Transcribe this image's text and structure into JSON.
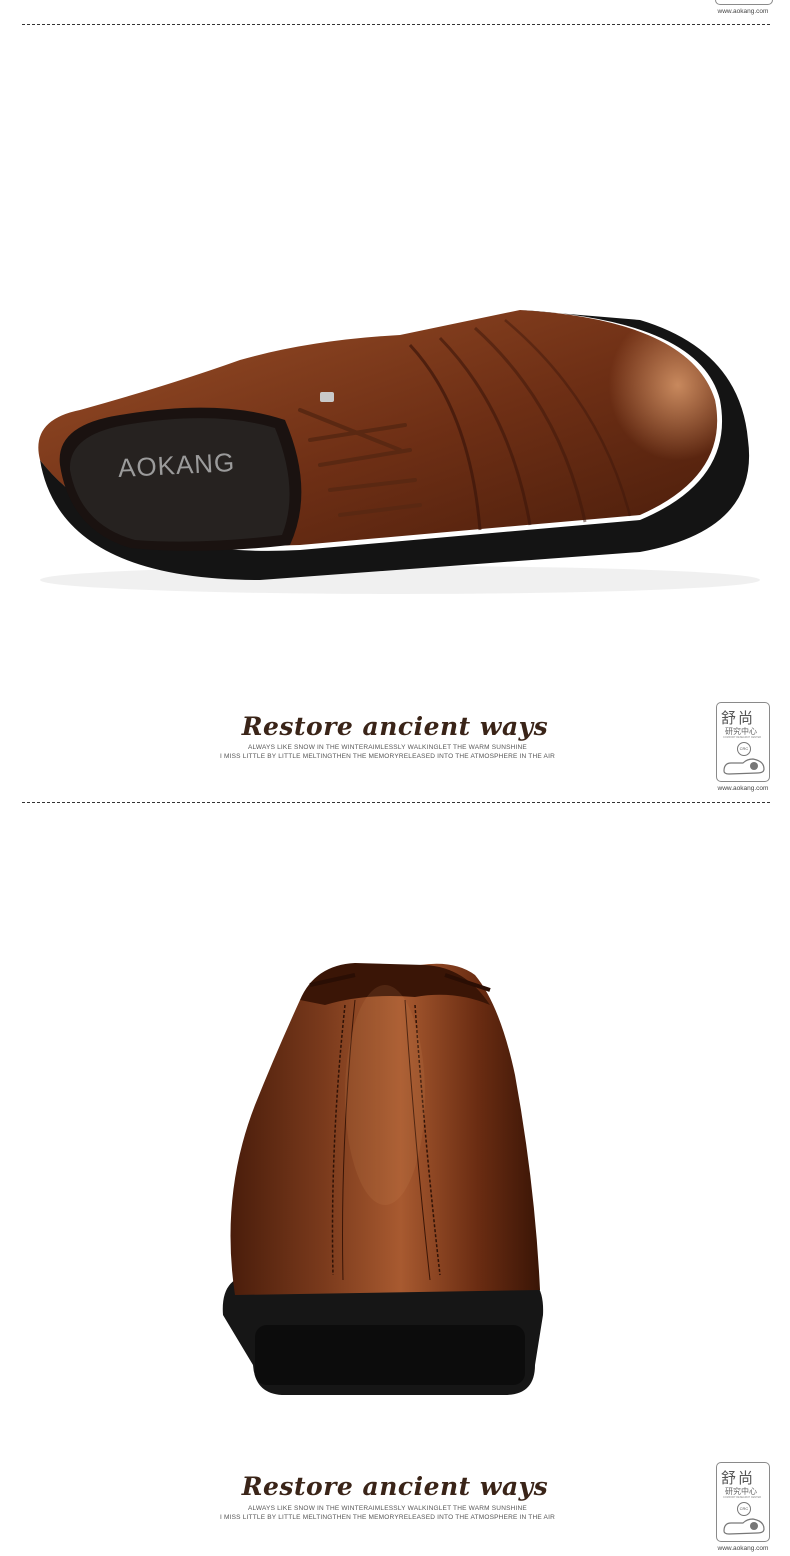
{
  "brand": {
    "insole_logo": "AOKANG"
  },
  "sections": [
    {
      "title": "Restore ancient ways",
      "line1": "ALWAYS LIKE SNOW IN THE WINTERAIMLESSLY WALKINGLET THE WARM SUNSHINE",
      "line2": "I MISS LITTLE BY LITTLE MELTINGTHEN THE MEMORYRELEASED INTO THE ATMOSPHERE IN THE AIR"
    },
    {
      "title": "Restore ancient ways",
      "line1": "ALWAYS LIKE SNOW IN THE WINTERAIMLESSLY WALKINGLET THE WARM SUNSHINE",
      "line2": "I MISS LITTLE BY LITTLE MELTINGTHEN THE MEMORYRELEASED INTO THE ATMOSPHERE IN THE AIR"
    }
  ],
  "badge": {
    "cn_title": "舒尚",
    "cn_sub": "研究中心",
    "en_sub": "COMFORT RESEARCH CENTER",
    "crc": "CRC",
    "url": "www.aokang.com"
  },
  "colors": {
    "leather": "#7a3a1c",
    "leather_light": "#b8683a",
    "sole": "#141414",
    "caption": "#3a2418"
  }
}
